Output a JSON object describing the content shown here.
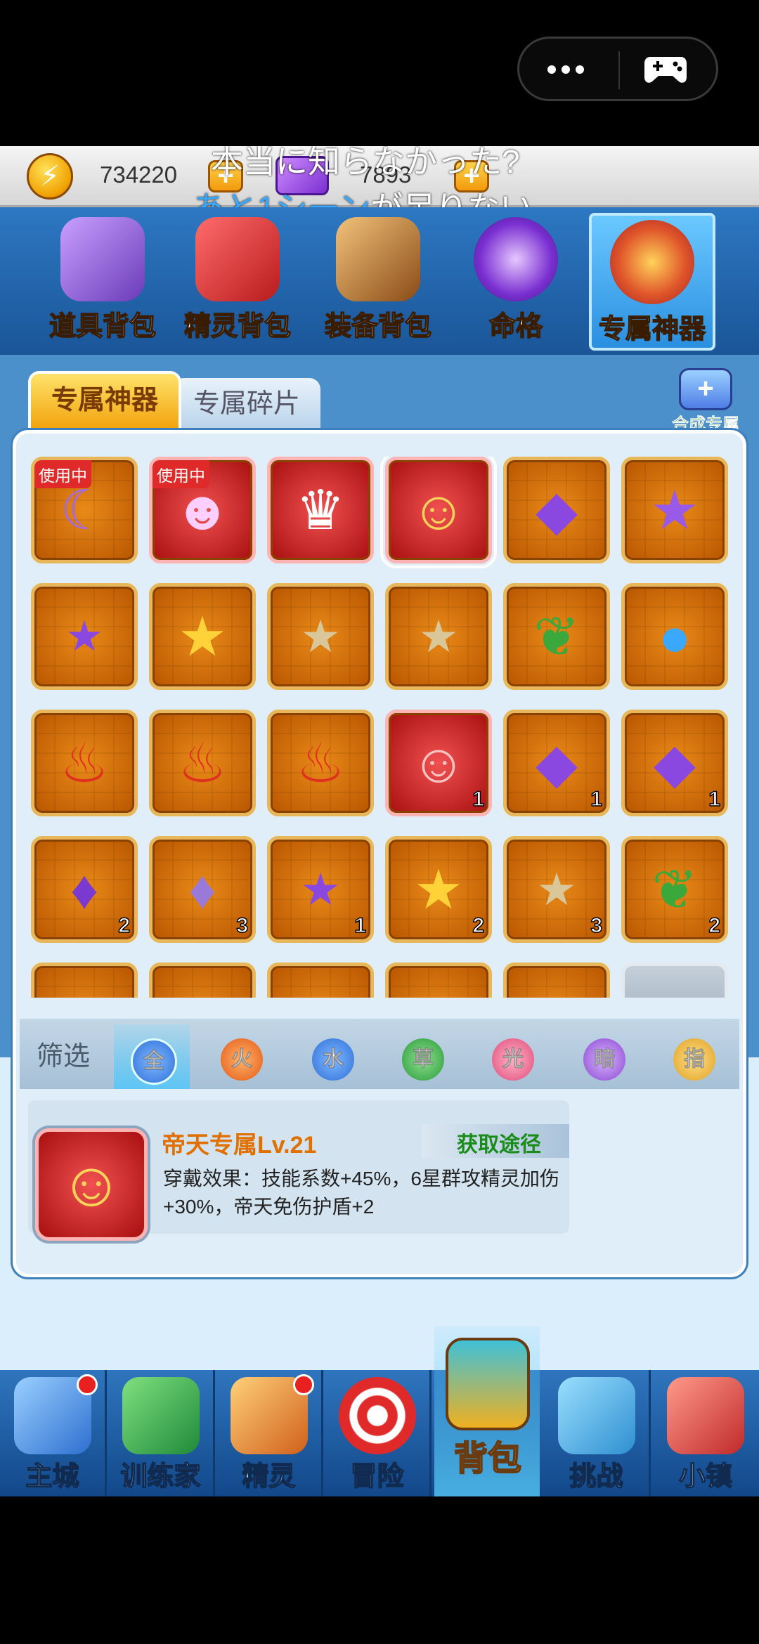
{
  "status": {
    "more_icon": "more-dots-icon",
    "gamepad_icon": "gamepad-icon"
  },
  "resources": {
    "coin": "734220",
    "gem": "7893",
    "plus": "+"
  },
  "overlay": {
    "line1": "本当に知らなかった?",
    "line2_blue": "あと1シーン",
    "line2_white": "が足りない"
  },
  "categories": [
    "道具背包",
    "精灵背包",
    "装备背包",
    "命格",
    "专属神器"
  ],
  "tabs": {
    "active": "专属神器",
    "inactive": "专属碎片",
    "combine": "合成专属"
  },
  "grid": {
    "in_use": "使用中",
    "counts": [
      "1",
      "1",
      "1",
      "2",
      "3",
      "1",
      "2",
      "3",
      "2"
    ]
  },
  "filter": {
    "label": "筛选",
    "options": [
      "全",
      "火",
      "水",
      "草",
      "光",
      "暗",
      "指"
    ]
  },
  "detail": {
    "name": "帝天专属Lv.21",
    "get": "获取途径",
    "desc": "穿戴效果：技能系数+45%，6星群攻精灵加伤+30%，帝天免伤护盾+2"
  },
  "nav": [
    "主城",
    "训练家",
    "精灵",
    "冒险",
    "背包",
    "挑战",
    "小镇"
  ]
}
